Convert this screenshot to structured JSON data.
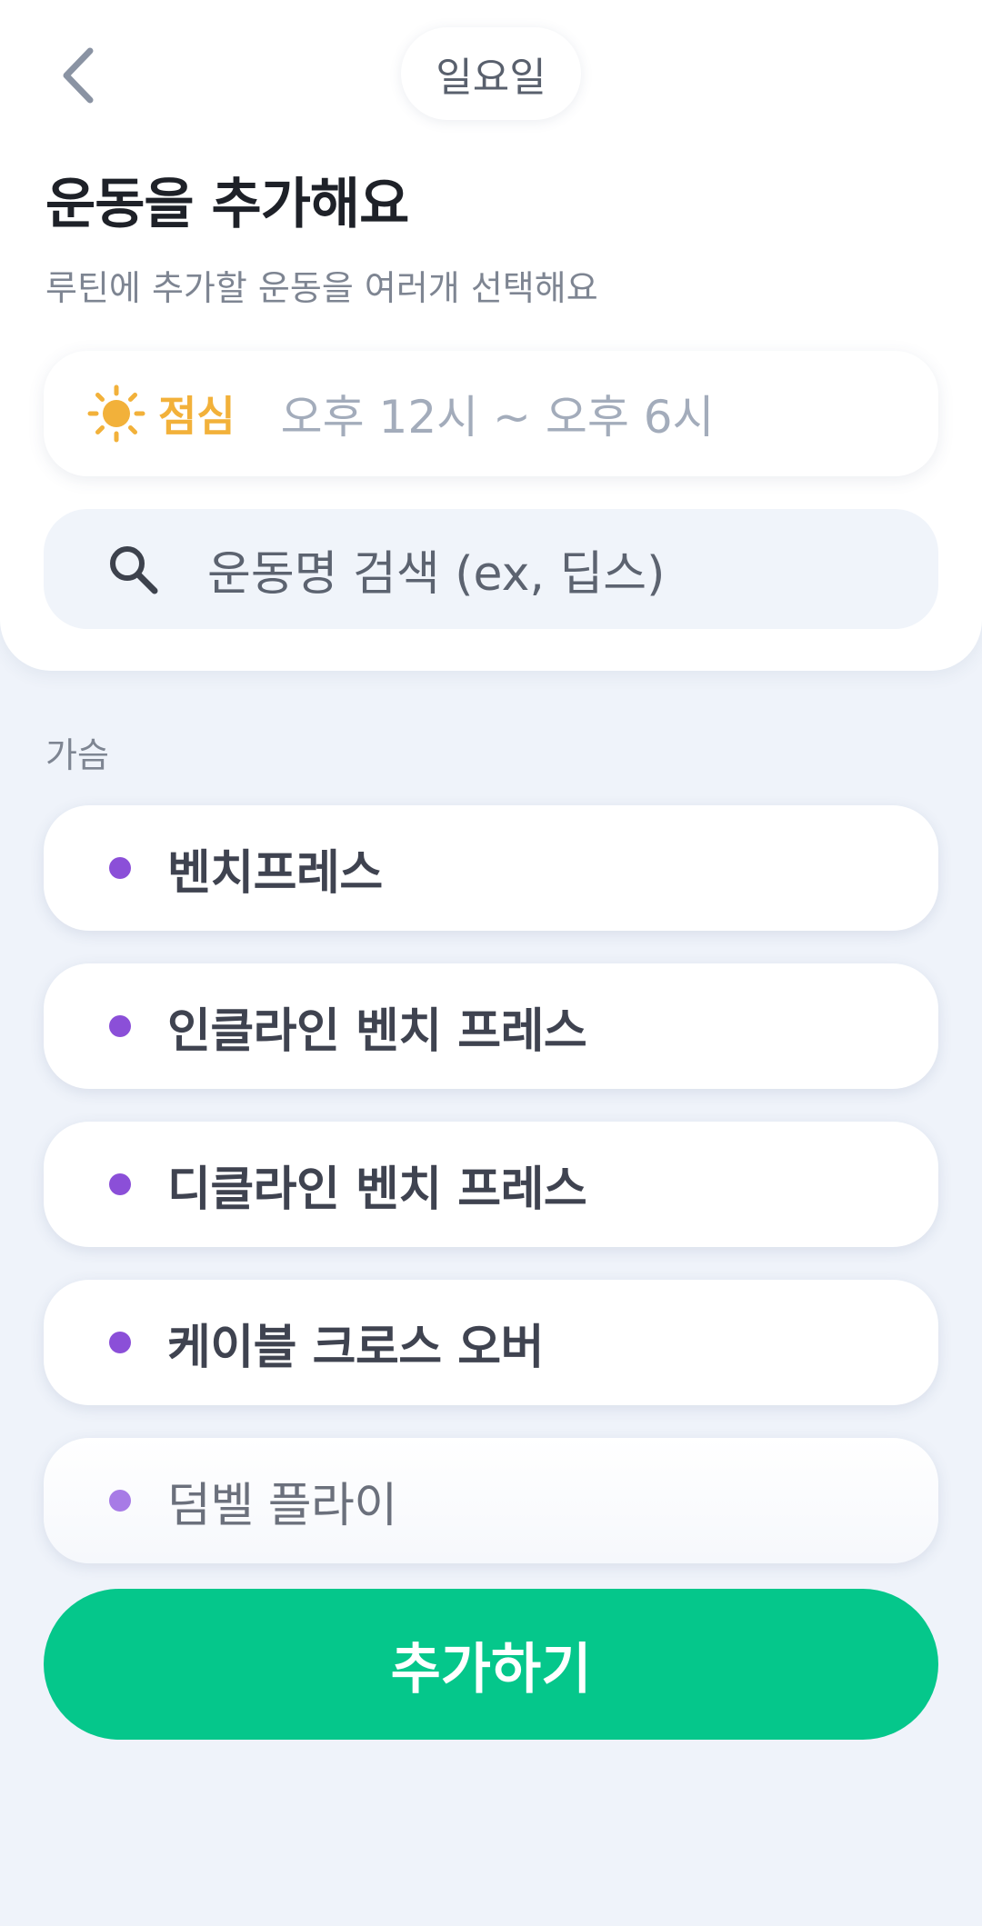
{
  "header": {
    "back_icon": "chevron-left-icon",
    "day": "일요일"
  },
  "title": "운동을 추가해요",
  "subtitle": "루틴에 추가할 운동을 여러개 선택해요",
  "time_slot": {
    "icon": "sun-icon",
    "label": "점심",
    "range": "오후 12시 ~ 오후 6시",
    "label_color": "#f2b13a"
  },
  "search": {
    "icon": "search-icon",
    "placeholder": "운동명 검색 (ex, 딥스)"
  },
  "category": "가슴",
  "exercises": [
    {
      "name": "벤치프레스"
    },
    {
      "name": "인클라인 벤치 프레스"
    },
    {
      "name": "디클라인 벤치 프레스"
    },
    {
      "name": "케이블 크로스 오버"
    },
    {
      "name": "덤벨 플라이"
    }
  ],
  "colors": {
    "accent": "#05c78b",
    "dot": "#8b4fd8",
    "background": "#eff3fa"
  },
  "add_button_label": "추가하기"
}
